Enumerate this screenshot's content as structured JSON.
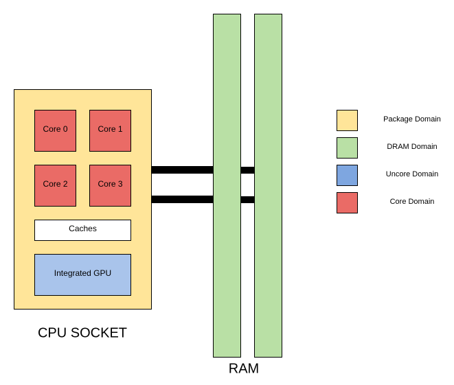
{
  "socket": {
    "label": "CPU SOCKET",
    "cores": [
      "Core 0",
      "Core 1",
      "Core 2",
      "Core 3"
    ],
    "caches": "Caches",
    "gpu": "Integrated GPU"
  },
  "ram": {
    "label": "RAM"
  },
  "legend": [
    {
      "label": "Package Domain",
      "color": "#FFE599"
    },
    {
      "label": "DRAM Domain",
      "color": "#B9E0A5"
    },
    {
      "label": "Uncore Domain",
      "color": "#7EA6E0"
    },
    {
      "label": "Core Domain",
      "color": "#EA6B66"
    }
  ],
  "colors": {
    "package": "#FFE599",
    "dram": "#B9E0A5",
    "core": "#EA6B66",
    "gpu": "#A9C4EB",
    "caches": "#FFFFFF",
    "link": "#000000"
  }
}
